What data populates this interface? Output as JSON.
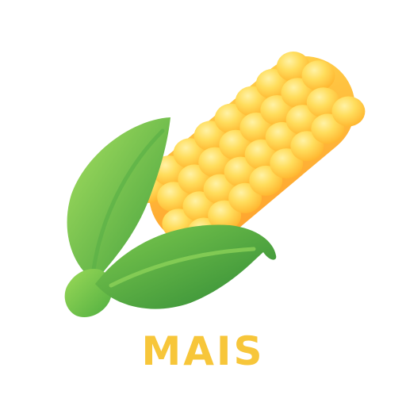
{
  "logo": {
    "icon": "corn-cob-icon",
    "word": "MAIS",
    "word_color": "#F7C63A",
    "kernel_colors": [
      "#FFE27A",
      "#FFC83A",
      "#FFAA2C"
    ],
    "husk_colors": [
      "#9FDC5A",
      "#6CC04A",
      "#3E9B3C"
    ]
  }
}
